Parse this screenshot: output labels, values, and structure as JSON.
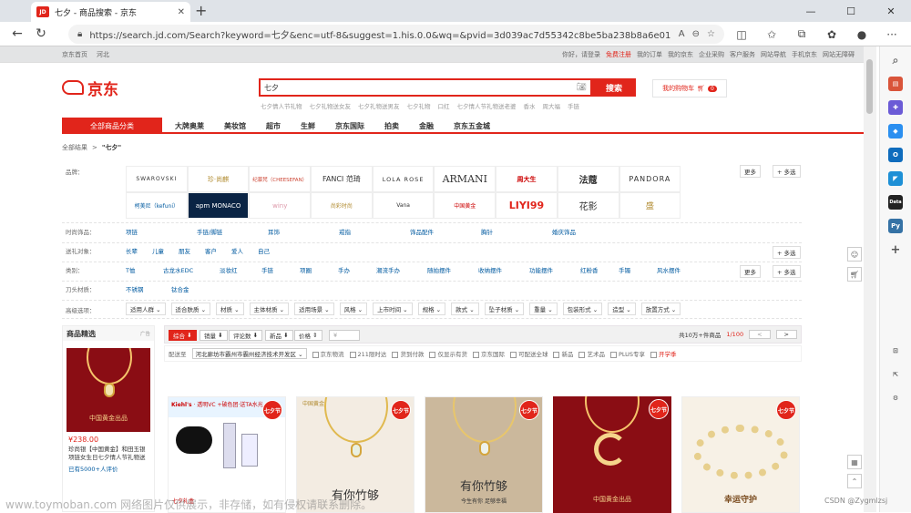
{
  "browser": {
    "tab_title": "七夕 - 商品搜索 - 京东",
    "tab_favicon": "JD",
    "url": "https://search.jd.com/Search?keyword=七夕&enc=utf-8&suggest=1.his.0.0&wq=&pvid=3d039ac7d55342c8be5ba238b8a6e012"
  },
  "topbar": {
    "left": [
      "京东首页",
      "河北"
    ],
    "right": [
      "你好，请登录",
      "免费注册",
      "我的订单",
      "我的京东",
      "企业采购",
      "客户服务",
      "网站导航",
      "手机京东",
      "网站无障碍"
    ]
  },
  "header": {
    "logo": "京东",
    "search_query": "七夕",
    "search_button": "搜索",
    "cart_label": "我的购物车",
    "cart_count": "0",
    "hotwords": [
      "七夕情人节礼物",
      "七夕礼物送女友",
      "七夕礼物送男友",
      "七夕礼物",
      "口红",
      "七夕情人节礼物送老婆",
      "香水",
      "周大福",
      "手链"
    ]
  },
  "catnav": {
    "all": "全部商品分类",
    "items": [
      "大牌奥莱",
      "美妆馆",
      "超市",
      "生鲜",
      "京东国际",
      "拍卖",
      "金融",
      "京东五金城"
    ]
  },
  "breadcrumb": {
    "all": "全部结果",
    "sep": ">",
    "kw": "\"七夕\""
  },
  "filters": {
    "brand_label": "品牌：",
    "brands": [
      "SWAROVSKI",
      "珍·尚麒",
      "纪慕梵（CHEESEFAN）",
      "FANCI 范琦",
      "LOLA ROSE",
      "ARMANI",
      "周大生",
      "法蔻",
      "PANDORA",
      "柯美尼（kefuni）",
      "apm MONACO",
      "winy",
      "尚彩时尚",
      "Vana",
      "中国黄金",
      "LIYI99",
      "花影",
      "盛"
    ],
    "more": "更多",
    "multi": "+ 多选",
    "rows": [
      {
        "label": "时尚饰品：",
        "values": [
          "项链",
          "手链/脚链",
          "耳饰",
          "戒指",
          "饰品配件",
          "胸针",
          "婚庆饰品"
        ]
      },
      {
        "label": "送礼对象：",
        "values": [
          "长辈",
          "儿童",
          "朋友",
          "客户",
          "爱人",
          "自己"
        ]
      },
      {
        "label": "类别：",
        "values": [
          "T恤",
          "古龙水EDC",
          "淡妆红",
          "手链",
          "项圈",
          "手办",
          "潮流手办",
          "随拍摆件",
          "收纳摆件",
          "功能摆件",
          "红粉香",
          "手镯",
          "风水摆件"
        ]
      },
      {
        "label": "刀头材质：",
        "values": [
          "不锈钢",
          "钛合金"
        ]
      }
    ],
    "advanced_label": "高级选项：",
    "advanced": [
      "适用人群",
      "适合肤质",
      "材质",
      "主体材质",
      "适用场景",
      "风格",
      "上市时间",
      "规格",
      "款式",
      "坠子材质",
      "重量",
      "包装形式",
      "造型",
      "放置方式"
    ]
  },
  "sortbar": {
    "items": [
      "综合",
      "销量",
      "评论数",
      "新品",
      "价格"
    ],
    "price_placeholder": "¥",
    "count": "共10万+件商品",
    "page": "1/100",
    "prev": "<",
    "next": ">"
  },
  "deliver": {
    "label": "配送至",
    "location": "河北廊坊市霸州市霸州经济技术开发区",
    "options": [
      "京东物流",
      "211限时达",
      "货到付款",
      "仅显示有货",
      "京东国际",
      "可配送全球",
      "新品",
      "艺术品",
      "PLUS专享",
      "开学季"
    ]
  },
  "rec": {
    "title": "商品精选",
    "ad": "广告",
    "price": "¥238.00",
    "desc": "珍尚银【中国黄金】和田玉银项链女生日七夕情人节礼物送",
    "comments": "已有5000+人评价",
    "capt": "中国黄金出品"
  },
  "products": [
    {
      "tag": "七夕节",
      "kind": "cosmetics",
      "brand": "Kiehl's",
      "line1": "透明VC +破色团·送TA水光",
      "line2": "七夕礼盒"
    },
    {
      "tag": "七夕节",
      "kind": "necklace-light",
      "brand": "中国黄金",
      "line1": "有你竹够",
      "line2": ""
    },
    {
      "tag": "七夕节",
      "kind": "necklace-light",
      "brand": "",
      "line1": "有你竹够",
      "line2": "今生有你 足够幸福"
    },
    {
      "tag": "七夕节",
      "kind": "necklace-red",
      "brand": "",
      "line1": "中国黄金出品",
      "line2": ""
    },
    {
      "tag": "七夕节",
      "kind": "bracelet",
      "brand": "",
      "line1": "幸运守护",
      "line2": ""
    }
  ],
  "watermark": "www.toymoban.com 网络图片仅供展示，非存储，如有侵权请联系删除。",
  "csdn": "CSDN @Zygmlzsj"
}
